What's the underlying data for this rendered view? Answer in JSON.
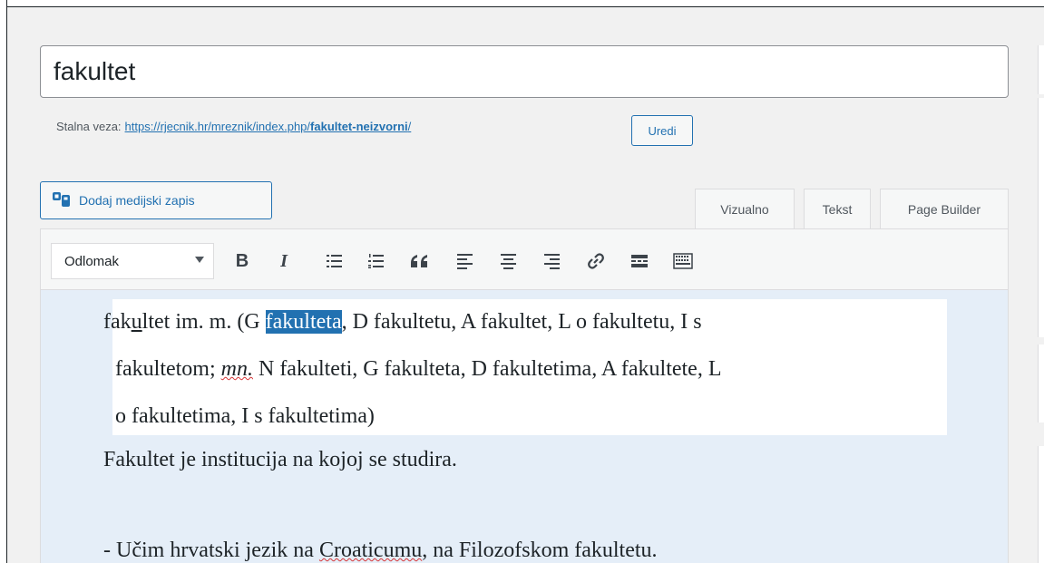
{
  "title_field": {
    "value": "fakultet"
  },
  "permalink": {
    "label": "Stalna veza:",
    "url_prefix": "https://rjecnik.hr/mreznik/index.php/",
    "slug": "fakultet-neizvorni",
    "url_suffix": "/",
    "edit_label": "Uredi"
  },
  "media_button": {
    "label": "Dodaj medijski zapis",
    "icon": "media-icon"
  },
  "editor_tabs": [
    {
      "label": "Vizualno"
    },
    {
      "label": "Tekst"
    },
    {
      "label": "Page Builder"
    }
  ],
  "toolbar": {
    "format_select": "Odlomak",
    "buttons": [
      {
        "icon": "bold-icon",
        "glyph": "B"
      },
      {
        "icon": "italic-icon",
        "glyph": "I"
      },
      {
        "icon": "bullet-list-icon",
        "glyph": "☰"
      },
      {
        "icon": "numbered-list-icon",
        "glyph": "☰"
      },
      {
        "icon": "blockquote-icon",
        "glyph": "❝"
      },
      {
        "icon": "align-left-icon",
        "glyph": "≡"
      },
      {
        "icon": "align-center-icon",
        "glyph": "≡"
      },
      {
        "icon": "align-right-icon",
        "glyph": "≡"
      },
      {
        "icon": "link-icon",
        "glyph": "🔗"
      },
      {
        "icon": "read-more-icon",
        "glyph": "▬"
      },
      {
        "icon": "toolbar-toggle-icon",
        "glyph": "▦"
      }
    ]
  },
  "content": {
    "line1_a": "fak",
    "line1_u": "u",
    "line1_b": "ltet im. m. (G ",
    "line1_sel": "fakulteta",
    "line1_c": ", D fakultetu, A fakultet, L o fakultetu, I s",
    "line2_a": "fakultetom; ",
    "line2_mn": "mn.",
    "line2_b": " N fakulteti, G fakulteta, D fakultetima, A fakultete, L",
    "line3": "o fakultetima, I s fakultetima)",
    "line4": "Fakultet je institucija na kojoj se studira.",
    "line5_a": "- Učim hrvatski jezik na ",
    "line5_croaticum": "Croaticumu",
    "line5_b": ", na Filozofskom fakultetu."
  },
  "colors": {
    "accent": "#2271b1",
    "editor_bg": "#e5eef8",
    "selection": "#2271b1"
  }
}
